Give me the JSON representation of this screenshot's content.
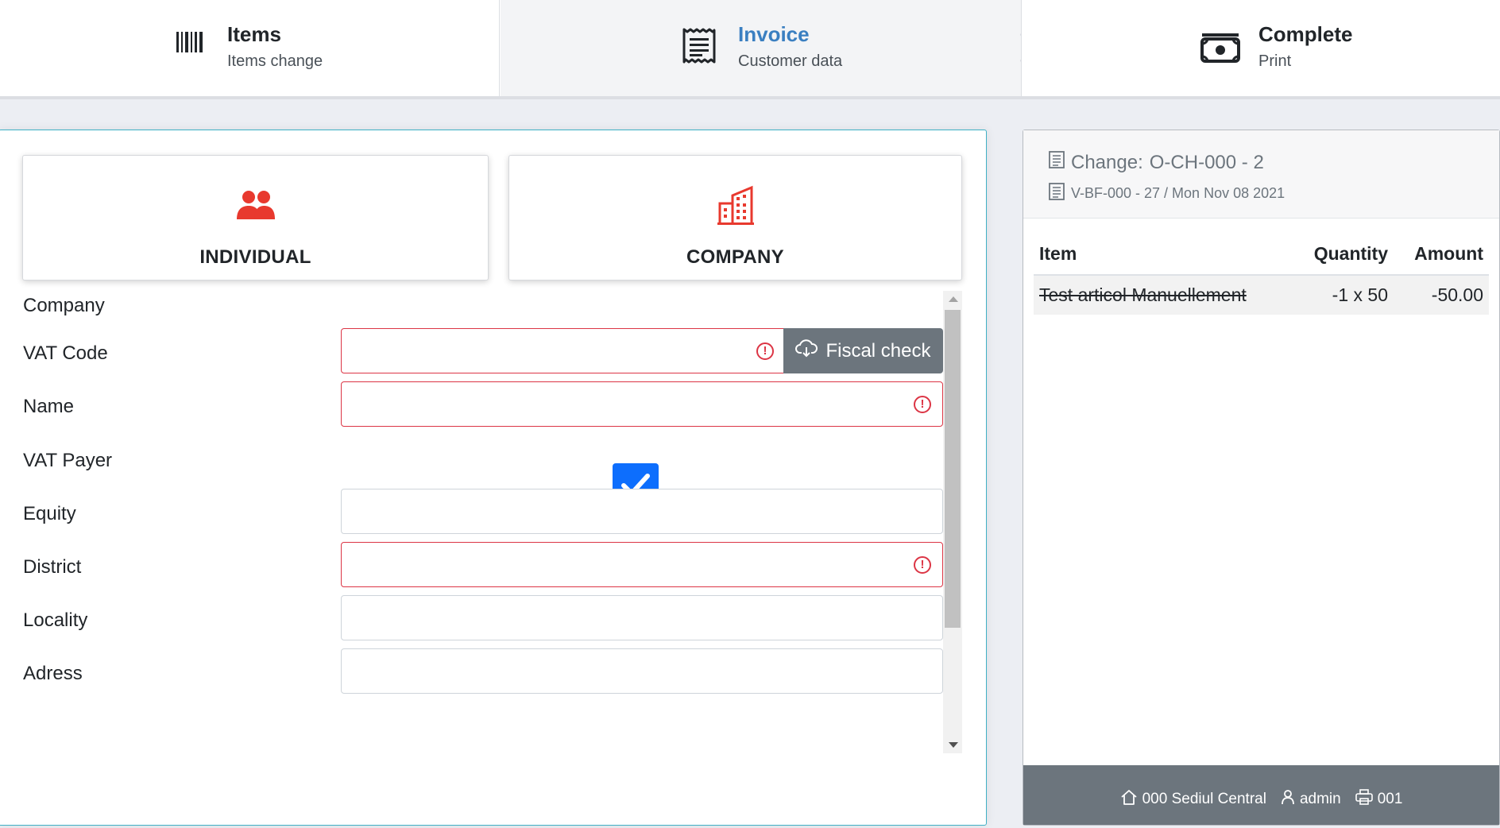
{
  "stepper": {
    "steps": [
      {
        "title": "Items",
        "subtitle": "Items change",
        "icon": "barcode-icon"
      },
      {
        "title": "Invoice",
        "subtitle": "Customer data",
        "icon": "receipt-icon"
      },
      {
        "title": "Complete",
        "subtitle": "Print",
        "icon": "cash-icon"
      }
    ],
    "active_color": "#3a7fc1"
  },
  "customer_type": {
    "individual_label": "INDIVIDUAL",
    "company_label": "COMPANY",
    "icon_color": "#e8392e"
  },
  "form": {
    "section_label": "Company",
    "vat_code_label": "VAT Code",
    "vat_code_value": "",
    "fiscal_check_label": "Fiscal check",
    "name_label": "Name",
    "name_value": "",
    "vat_payer_label": "VAT Payer",
    "vat_payer_checked": true,
    "equity_label": "Equity",
    "equity_value": "",
    "district_label": "District",
    "district_value": "",
    "locality_label": "Locality",
    "locality_value": "",
    "address_label": "Adress",
    "address_value": ""
  },
  "receipt": {
    "change_label": "Change:",
    "change_number": "O-CH-000 - 2",
    "document_ref": "V-BF-000 - 27 / Mon Nov 08 2021",
    "columns": [
      "Item",
      "Quantity",
      "Amount"
    ],
    "rows": [
      {
        "item": "Test articol Manuellement",
        "quantity": "-1 x 50",
        "amount": "-50.00",
        "struck": true
      }
    ],
    "footer": {
      "location": "000 Sediul Central",
      "user": "admin",
      "printer": "001"
    }
  },
  "colors": {
    "invalid": "#dc3545",
    "checkbox": "#0d6efd",
    "secondary": "#6c757d",
    "panel_border": "#3fb0c5"
  }
}
